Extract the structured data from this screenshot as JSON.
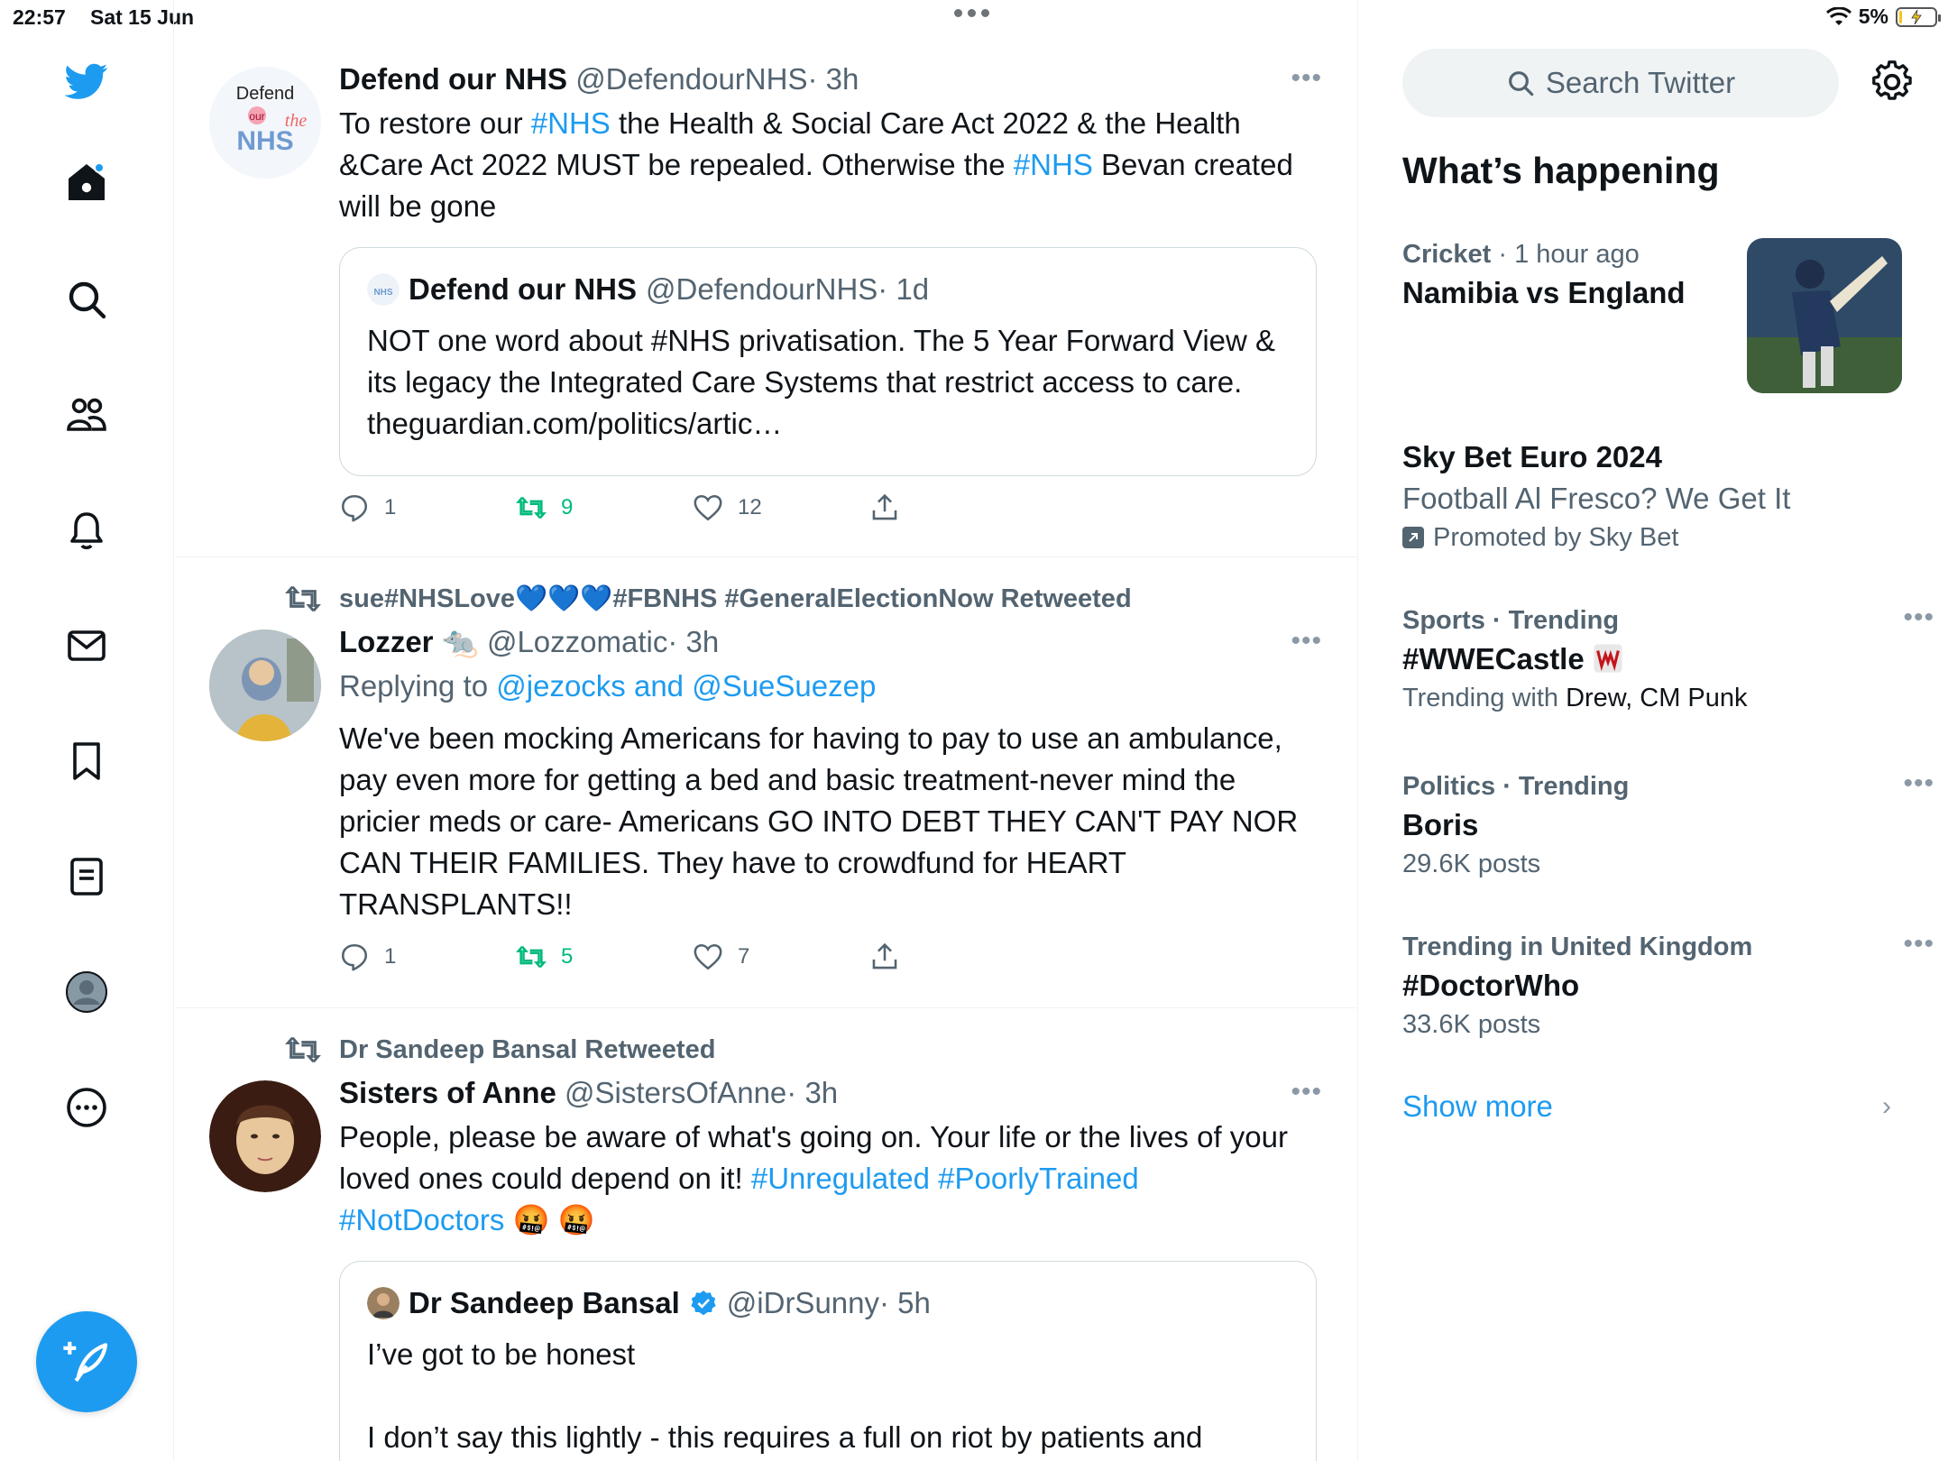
{
  "status": {
    "time": "22:57",
    "date": "Sat 15 Jun",
    "battery": "5%"
  },
  "nav": {
    "items": [
      "home",
      "explore",
      "communities",
      "notifications",
      "messages",
      "bookmarks",
      "lists",
      "profile",
      "more"
    ]
  },
  "search": {
    "placeholder": "Search Twitter"
  },
  "tweets": [
    {
      "name": "Defend our NHS",
      "handle": "@DefendourNHS",
      "time": "· 3h",
      "avatar_text_1": "Defend",
      "avatar_text_2": "our",
      "avatar_text_3": "NHS",
      "avatar_text_4": "the",
      "text_1": "To restore our ",
      "text_link_1": "#NHS",
      "text_2": " the Health & Social Care Act 2022 & the Health &Care Act 2022 MUST be repealed. Otherwise the ",
      "text_link_2": "#NHS",
      "text_3": " Bevan created will be gone",
      "quote": {
        "name": "Defend our NHS",
        "handle": "@DefendourNHS",
        "time": "· 1d",
        "text": "NOT one word about #NHS privatisation. The 5 Year Forward View & its legacy the Integrated Care Systems that restrict access to care. theguardian.com/politics/artic…"
      },
      "replies": "1",
      "retweets": "9",
      "likes": "12"
    },
    {
      "retweeted_by": "sue#NHSLove💙💙💙#FBNHS #GeneralElectionNow Retweeted",
      "name": "Lozzer 🐀",
      "handle": "@Lozzomatic",
      "time": "· 3h",
      "reply_prefix": "Replying to ",
      "reply_to": "@jezocks and @SueSuezep",
      "text": "We've been mocking Americans for having to pay to use an ambulance, pay even more for getting a bed and basic treatment-never mind the pricier meds or care- Americans GO INTO DEBT THEY CAN'T PAY NOR CAN THEIR FAMILIES. They have to crowdfund for HEART TRANSPLANTS!!",
      "replies": "1",
      "retweets": "5",
      "likes": "7"
    },
    {
      "retweeted_by": "Dr Sandeep Bansal Retweeted",
      "name": "Sisters of Anne",
      "handle": "@SistersOfAnne",
      "time": "· 3h",
      "text_1": "People, please be aware of what's going on. Your life or the lives of your loved ones could depend on it! ",
      "text_link_1": "#Unregulated #PoorlyTrained",
      "text_link_2": "#NotDoctors",
      "text_emoji": " 🤬 🤬",
      "quote": {
        "name": "Dr Sandeep Bansal",
        "handle": "@iDrSunny",
        "time": "· 5h",
        "text_1": "I’ve got to be honest",
        "text_2": "I don’t say this lightly - this requires a full on riot by patients and"
      }
    }
  ],
  "sidebar": {
    "title": "What’s happening",
    "trends": [
      {
        "context_bold": "Cricket",
        "context_rest": " · 1 hour ago",
        "topic": "Namibia vs England"
      },
      {
        "topic": "Sky Bet Euro 2024",
        "subtitle": "Football Al Fresco? We Get It",
        "promoted": "Promoted by Sky Bet"
      },
      {
        "context": "Sports · Trending",
        "topic": "#WWECastle",
        "sub_prefix": "Trending with ",
        "sub_names": "Drew, CM Punk"
      },
      {
        "context": "Politics · Trending",
        "topic": "Boris",
        "sub": "29.6K posts"
      },
      {
        "context": "Trending in United Kingdom",
        "topic": "#DoctorWho",
        "sub": "33.6K posts"
      }
    ],
    "show_more": "Show more"
  },
  "colors": {
    "accent": "#1d9bf0",
    "retweet": "#00ba7c",
    "muted": "#536471"
  }
}
